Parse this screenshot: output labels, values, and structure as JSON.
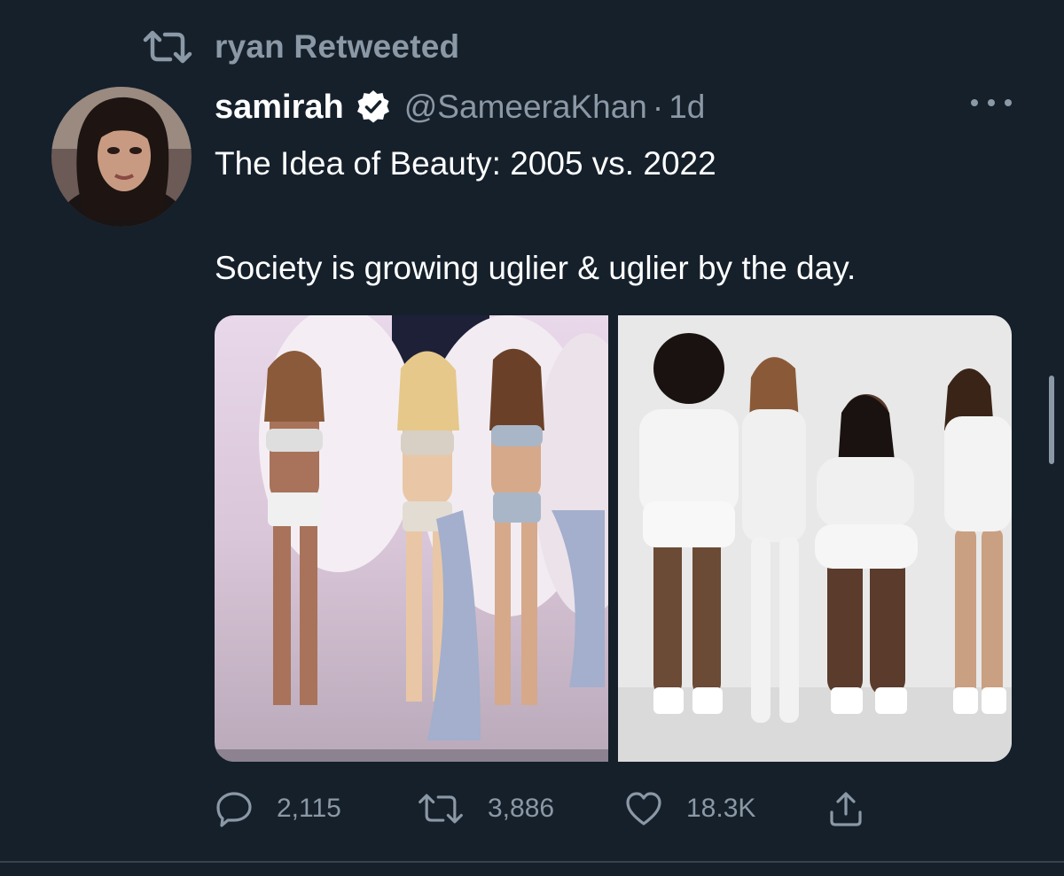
{
  "retweet_context": {
    "text": "ryan Retweeted",
    "icon": "retweet-icon"
  },
  "tweet": {
    "author": {
      "display_name": "samirah",
      "handle": "@SameeraKhan",
      "verified": true,
      "avatar": "avatar-photo"
    },
    "separator": "·",
    "timestamp": "1d",
    "text_lines": [
      "The Idea of Beauty: 2005 vs. 2022",
      "Society is growing uglier & uglier by the day."
    ],
    "media": [
      {
        "name": "photo-2005-runway",
        "description_icon": "image-icon"
      },
      {
        "name": "photo-2022-models",
        "description_icon": "image-icon"
      }
    ],
    "actions": {
      "replies": "2,115",
      "retweets": "3,886",
      "likes": "18.3K"
    }
  },
  "colors": {
    "background": "#15202b",
    "secondary_text": "#8b98a5",
    "primary_text": "#ffffff",
    "divider": "#38444d"
  }
}
